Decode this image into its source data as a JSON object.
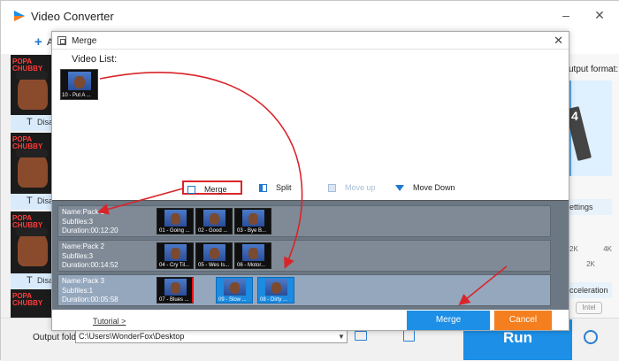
{
  "app": {
    "title": "Video Converter",
    "add_label": "A"
  },
  "colors": {
    "accent": "#1d8fe6",
    "cancel": "#f57f1f",
    "annotation": "#d9252a",
    "pack_bg": "#7f8a96",
    "pack_selected_bg": "#95a7bd"
  },
  "sidebar": {
    "thumb_text": "POPA CHUBBY",
    "disable_label": "Disal"
  },
  "right_panel": {
    "output_format_label": "utput format:",
    "settings_label": "ettings",
    "slider_label_low": "2K",
    "slider_label_high": "4K",
    "slider_label_mid": "2K",
    "acceleration_label": "cceleration",
    "intel_label": "Intel",
    "format_number": "4"
  },
  "dialog": {
    "title": "Merge",
    "video_list_label": "Video List:",
    "video_list_items": [
      {
        "caption": "10 - Put A ..."
      }
    ],
    "toolbar": {
      "merge": "Merge",
      "split": "Split",
      "move_up": "Move up",
      "move_down": "Move Down"
    },
    "packs": [
      {
        "name": "Name:Pack 1",
        "subfiles": "Subfiles:3",
        "duration": "Duration:00:12:20",
        "clips": [
          "01 - Going ...",
          "02 - Good ...",
          "03 - Bye B..."
        ]
      },
      {
        "name": "Name:Pack 2",
        "subfiles": "Subfiles:3",
        "duration": "Duration:00:14:52",
        "clips": [
          "04 - Cry Til...",
          "05 - Wes Is...",
          "06 - Motor..."
        ]
      },
      {
        "name": "Name:Pack 3",
        "subfiles": "Subfiles:1",
        "duration": "Duration:00:05:58",
        "clips": [
          "07 - Blues ...",
          "09 - Slow ...",
          "08 - Dirty ..."
        ]
      }
    ],
    "tutorial_link": "Tutorial >",
    "merge_button": "Merge",
    "cancel_button": "Cancel"
  },
  "bottom": {
    "output_folder_label": "Output folder:",
    "output_folder_value": "C:\\Users\\WonderFox\\Desktop",
    "run_button": "Run"
  }
}
